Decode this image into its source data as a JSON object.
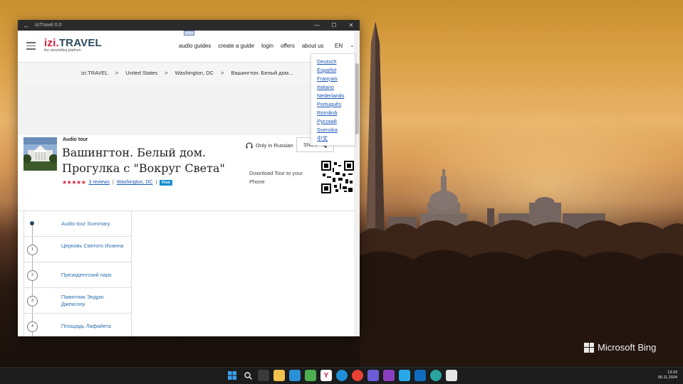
{
  "window": {
    "title": "iziTravel 0.0"
  },
  "header": {
    "logo_izi": "izi",
    "logo_travel": "TRAVEL",
    "tagline": "the storytelling platform",
    "nav": [
      "audio guides",
      "create a guide",
      "login",
      "offers",
      "about us"
    ],
    "language": "EN"
  },
  "language_menu": [
    "Deutsch",
    "Español",
    "Français",
    "Italiano",
    "Nederlands",
    "Português",
    "Română",
    "Русский",
    "Svenska",
    "中文"
  ],
  "breadcrumb": [
    "izi.TRAVEL",
    "United States",
    "Washington, DC",
    "Вашингтон. Белый дом..."
  ],
  "tour": {
    "type": "Audio tour",
    "title": "Вашингтон. Белый дом. Прогулка с \"Вокруг Света\"",
    "stars": "★★★★★",
    "reviews": "3 reviews",
    "city": "Washington, DC",
    "price": "Free",
    "language_note": "Only in Russian",
    "share": "Share",
    "download": "Download Tour to your Phone"
  },
  "stops": [
    {
      "num": "",
      "label": "Audio tour Summary"
    },
    {
      "num": "1",
      "label": "Церковь Святого Иоанна"
    },
    {
      "num": "2",
      "label": "Президентский парк"
    },
    {
      "num": "3",
      "label": "Памятник Эндрю Джексону"
    },
    {
      "num": "4",
      "label": "Площадь Лафайета"
    }
  ],
  "desktop": {
    "watermark": "Microsoft Bing"
  },
  "taskbar": {
    "time": "13:33",
    "date": "06.11.2024"
  },
  "colors": {
    "brand_red": "#d4213d",
    "brand_navy": "#2c4a5e",
    "link_blue": "#1a55b5",
    "free_badge": "#1a8fcf"
  }
}
